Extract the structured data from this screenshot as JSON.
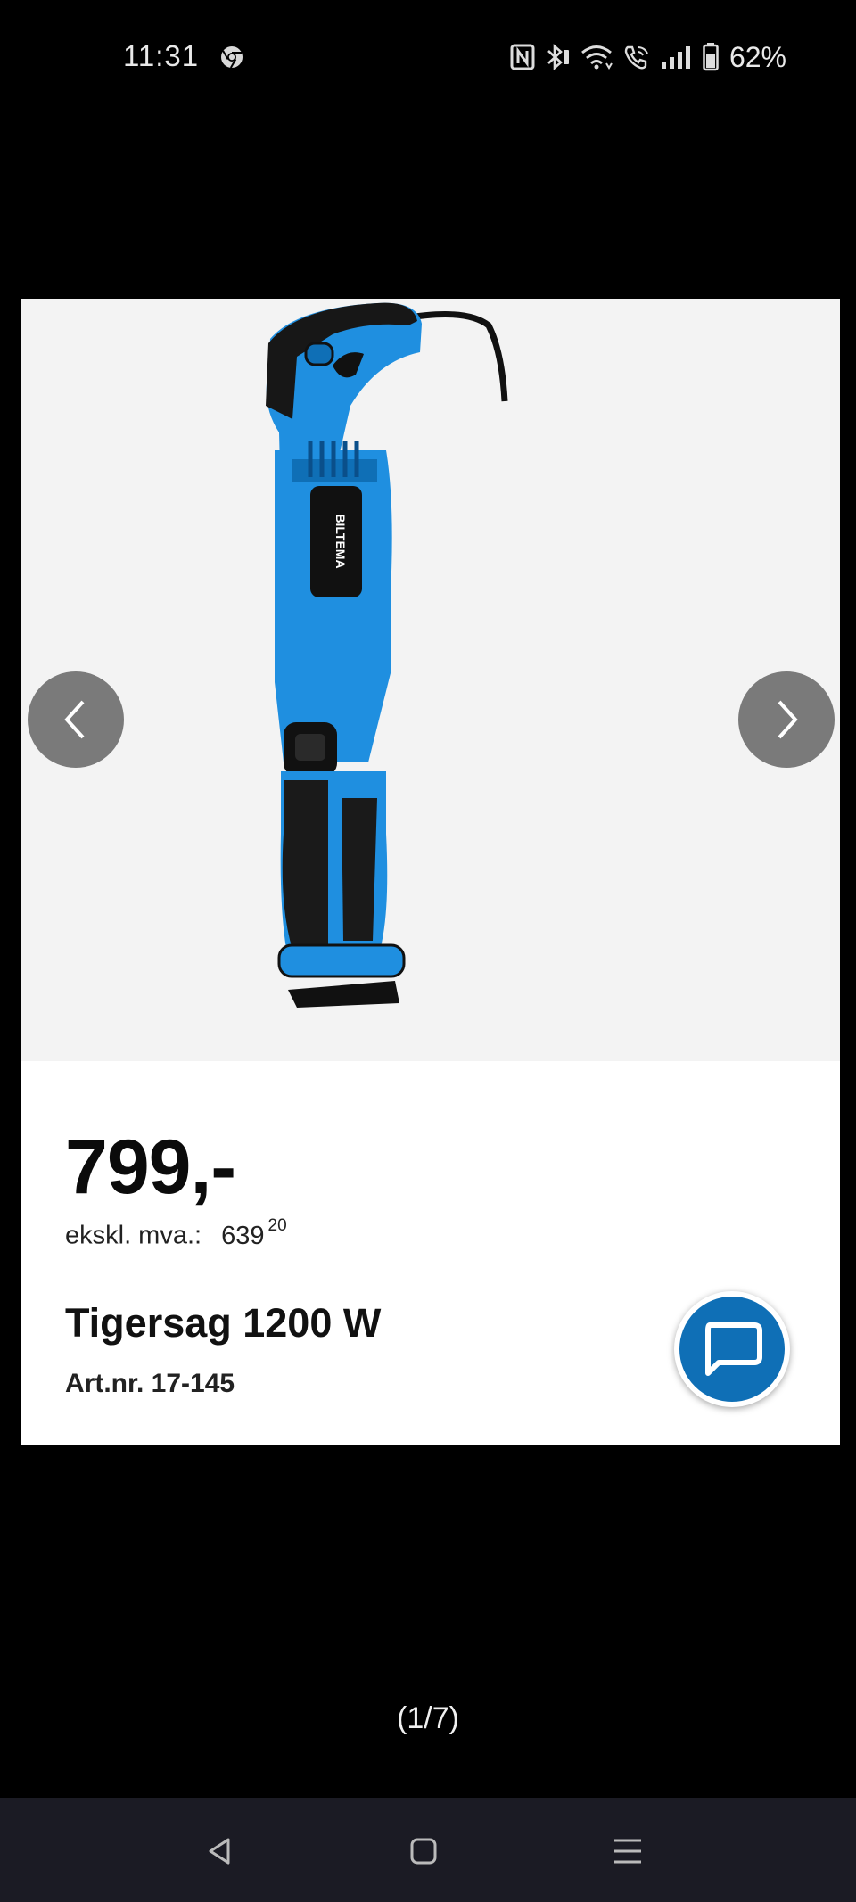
{
  "status_bar": {
    "time": "11:31",
    "battery_percent": "62%",
    "icons": [
      "chrome-icon",
      "nfc-icon",
      "bluetooth-icon",
      "wifi-icon",
      "wifi-call-icon",
      "signal-icon",
      "battery-icon"
    ]
  },
  "product": {
    "price": "799,-",
    "ex_vat_label": "ekskl. mva.:",
    "ex_vat_amount": "639",
    "ex_vat_cents": "20",
    "title": "Tigersag 1200 W",
    "art_nr": "Art.nr. 17-145",
    "brand": "BILTEMA",
    "image_alt": "reciprocating-saw-product-image"
  },
  "gallery": {
    "counter": "(1/7)",
    "prev_icon": "chevron-left-icon",
    "next_icon": "chevron-right-icon"
  },
  "chat": {
    "icon": "chat-bubble-icon"
  },
  "nav_bar": {
    "icons": [
      "back-icon",
      "home-icon",
      "recents-icon"
    ]
  },
  "colors": {
    "background": "#000000",
    "product_blue": "#1f8fe0",
    "chat_blue": "#0f6fb6",
    "arrow_gray": "#7a7a7a",
    "nav_bar": "#1b1b24"
  }
}
